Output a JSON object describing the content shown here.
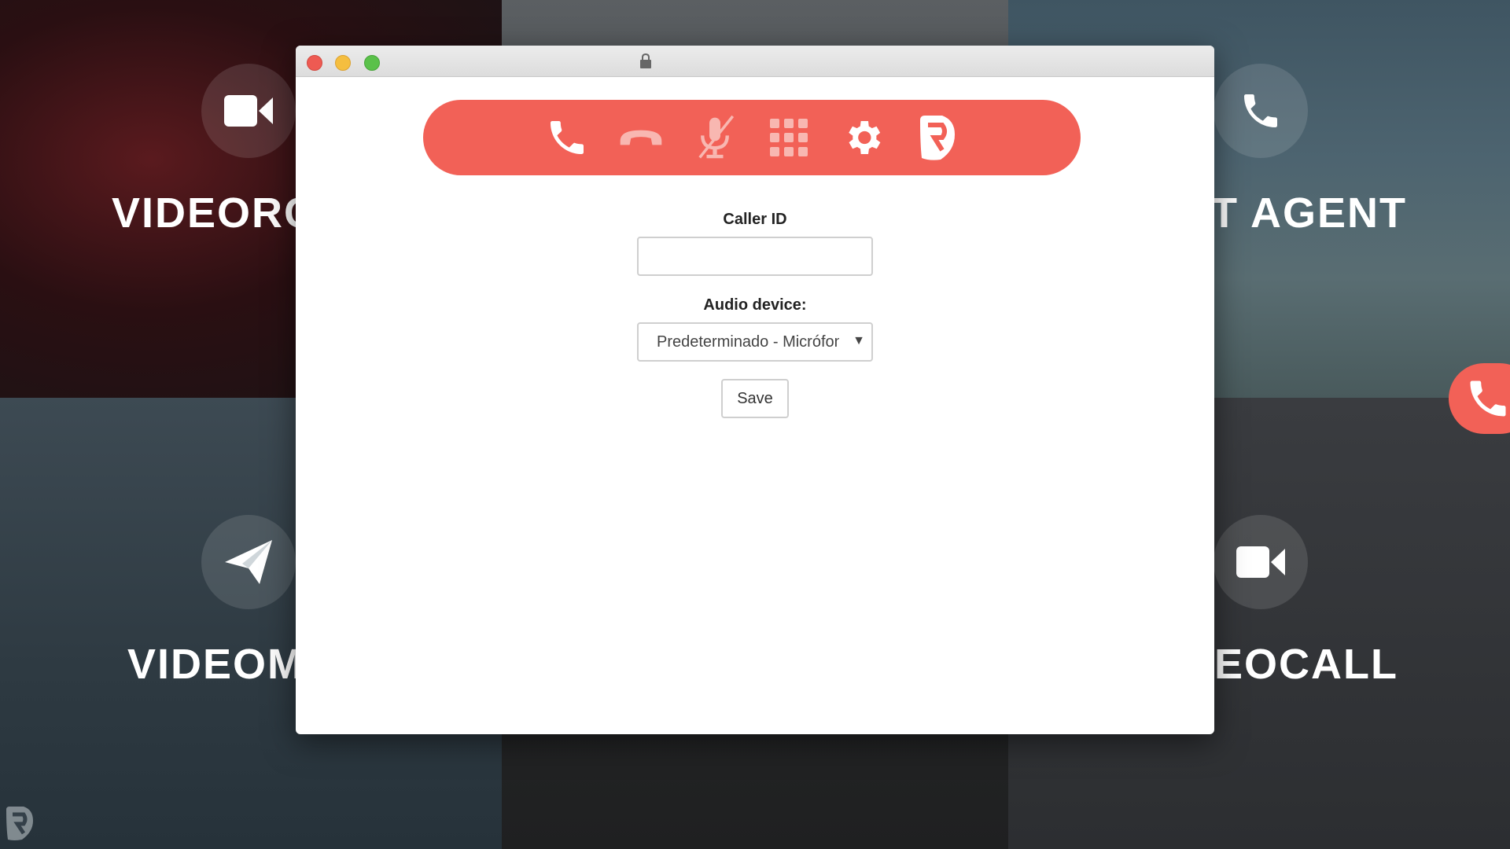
{
  "background": {
    "tiles": [
      {
        "label": "VIDEORC",
        "icon": "video-camera-icon"
      },
      {
        "label": "T AGENT",
        "icon": "phone-icon"
      },
      {
        "label": "VIDEOM",
        "icon": "paper-plane-icon"
      },
      {
        "label": "EOCALL",
        "icon": "video-camera-icon"
      }
    ]
  },
  "toolbar": {
    "accent": "#f26157",
    "buttons": [
      {
        "icon": "call-icon"
      },
      {
        "icon": "hang-up-icon"
      },
      {
        "icon": "mute-microphone-icon"
      },
      {
        "icon": "dialpad-icon"
      },
      {
        "icon": "settings-icon"
      },
      {
        "icon": "brand-logo-icon"
      }
    ]
  },
  "form": {
    "caller_id_label": "Caller ID",
    "caller_id_value": "",
    "audio_device_label": "Audio device:",
    "audio_device_selected": "Predeterminado - Micrófono",
    "save_label": "Save"
  }
}
